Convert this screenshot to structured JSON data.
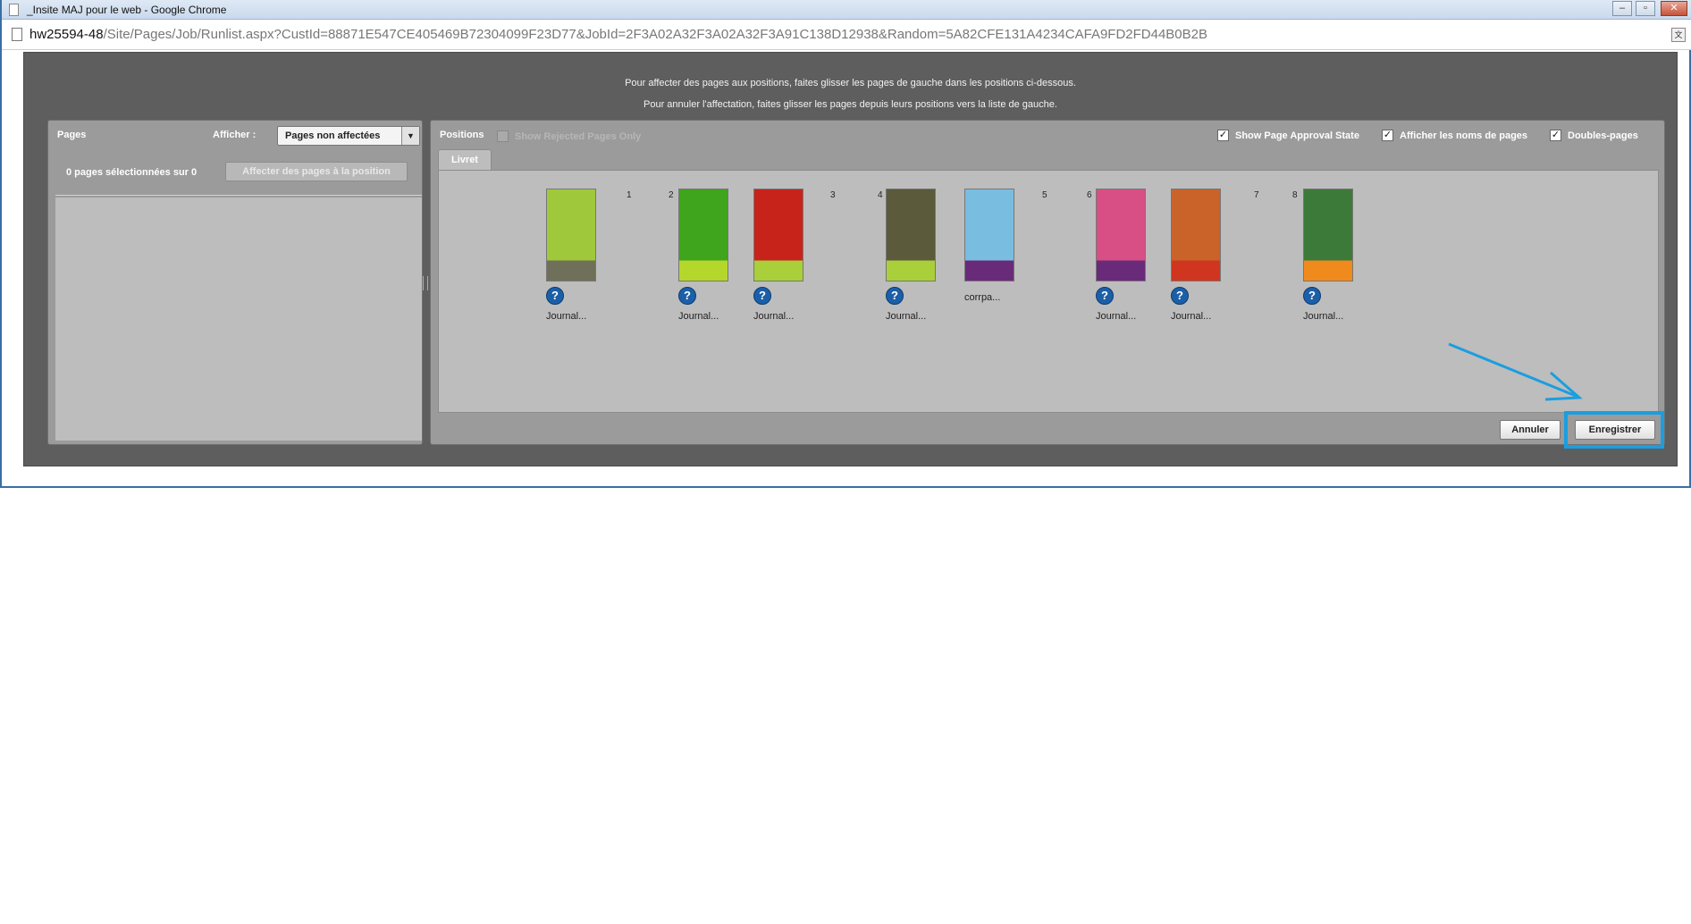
{
  "window": {
    "title": "_Insite MAJ pour le web - Google Chrome",
    "url_host": "hw25594-48",
    "url_path": "/Site/Pages/Job/Runlist.aspx?CustId=88871E547CE405469B72304099F23D77&JobId=2F3A02A32F3A02A32F3A91C138D12938&Random=5A82CFE131A4234CAFA9FD2FD44B0B2B"
  },
  "instructions": {
    "line1": "Pour affecter des pages aux positions, faites glisser les pages de gauche dans les positions ci-dessous.",
    "line2": "Pour annuler l'affectation, faites glisser les pages depuis leurs positions vers la liste de gauche."
  },
  "pages_panel": {
    "title": "Pages",
    "show_label": "Afficher :",
    "show_value": "Pages non affectées",
    "selection_text": "0 pages sélectionnées sur 0",
    "assign_button": "Affecter des pages à la position"
  },
  "positions_panel": {
    "title": "Positions",
    "show_rejected_label": "Show Rejected Pages Only",
    "show_approval_label": "Show Page Approval State",
    "show_names_label": "Afficher les noms de pages",
    "spreads_label": "Doubles-pages",
    "tab_label": "Livret",
    "positions": [
      {
        "num": "1",
        "label": "Journal...",
        "has_icon": true,
        "colors": [
          "#9fc93a",
          "#6f6f5a"
        ]
      },
      {
        "num": "2",
        "label": "Journal...",
        "has_icon": true,
        "colors": [
          "#3ea51c",
          "#b5d62a"
        ]
      },
      {
        "num": "3",
        "label": "Journal...",
        "has_icon": true,
        "colors": [
          "#c8231a",
          "#a9cf3a"
        ]
      },
      {
        "num": "4",
        "label": "Journal...",
        "has_icon": true,
        "colors": [
          "#5b5a3a",
          "#a9cf3a"
        ]
      },
      {
        "num": "5",
        "label": "corrpa...",
        "has_icon": false,
        "colors": [
          "#79bde0",
          "#6a2a7a"
        ]
      },
      {
        "num": "6",
        "label": "Journal...",
        "has_icon": true,
        "colors": [
          "#d84f86",
          "#6a2a7a"
        ]
      },
      {
        "num": "7",
        "label": "Journal...",
        "has_icon": true,
        "colors": [
          "#c9632a",
          "#d0351f"
        ]
      },
      {
        "num": "8",
        "label": "Journal...",
        "has_icon": true,
        "colors": [
          "#3c7a3a",
          "#f08a1c"
        ]
      }
    ]
  },
  "footer": {
    "cancel_label": "Annuler",
    "save_label": "Enregistrer"
  },
  "colors": {
    "highlight": "#1a9ee0",
    "dialog_bg": "#5e5e5e",
    "panel_bg": "#9b9b9b"
  }
}
